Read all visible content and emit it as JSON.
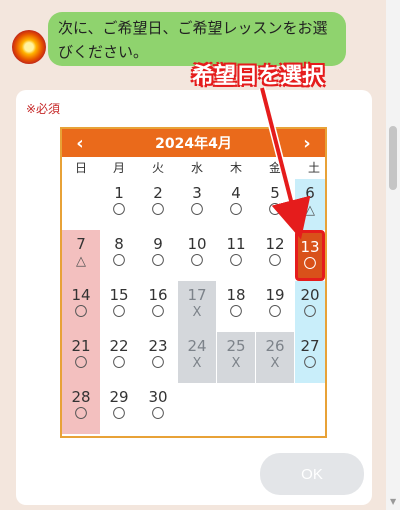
{
  "chat": {
    "message": "次に、ご希望日、ご希望レッスンをお選びください。"
  },
  "form": {
    "required_label": "※必須",
    "ok_label": "OK"
  },
  "calendar": {
    "month_label": "2024年4月",
    "prev_icon": "‹",
    "next_icon": "›",
    "weekdays": [
      "日",
      "月",
      "火",
      "水",
      "木",
      "金",
      "土"
    ],
    "days": [
      {
        "n": "1",
        "m": "〇"
      },
      {
        "n": "2",
        "m": "〇"
      },
      {
        "n": "3",
        "m": "〇"
      },
      {
        "n": "4",
        "m": "〇"
      },
      {
        "n": "5",
        "m": "〇"
      },
      {
        "n": "6",
        "m": "△"
      },
      {
        "n": "7",
        "m": "△"
      },
      {
        "n": "8",
        "m": "〇"
      },
      {
        "n": "9",
        "m": "〇"
      },
      {
        "n": "10",
        "m": "〇"
      },
      {
        "n": "11",
        "m": "〇"
      },
      {
        "n": "12",
        "m": "〇"
      },
      {
        "n": "13",
        "m": "〇"
      },
      {
        "n": "14",
        "m": "〇"
      },
      {
        "n": "15",
        "m": "〇"
      },
      {
        "n": "16",
        "m": "〇"
      },
      {
        "n": "17",
        "m": "X"
      },
      {
        "n": "18",
        "m": "〇"
      },
      {
        "n": "19",
        "m": "〇"
      },
      {
        "n": "20",
        "m": "〇"
      },
      {
        "n": "21",
        "m": "〇"
      },
      {
        "n": "22",
        "m": "〇"
      },
      {
        "n": "23",
        "m": "〇"
      },
      {
        "n": "24",
        "m": "X"
      },
      {
        "n": "25",
        "m": "X"
      },
      {
        "n": "26",
        "m": "X"
      },
      {
        "n": "27",
        "m": "〇"
      },
      {
        "n": "28",
        "m": "〇"
      },
      {
        "n": "29",
        "m": "〇"
      },
      {
        "n": "30",
        "m": "〇"
      }
    ],
    "selected_day": "13"
  },
  "annotation": {
    "text": "希望日を選択",
    "color": "#e51c1c"
  }
}
